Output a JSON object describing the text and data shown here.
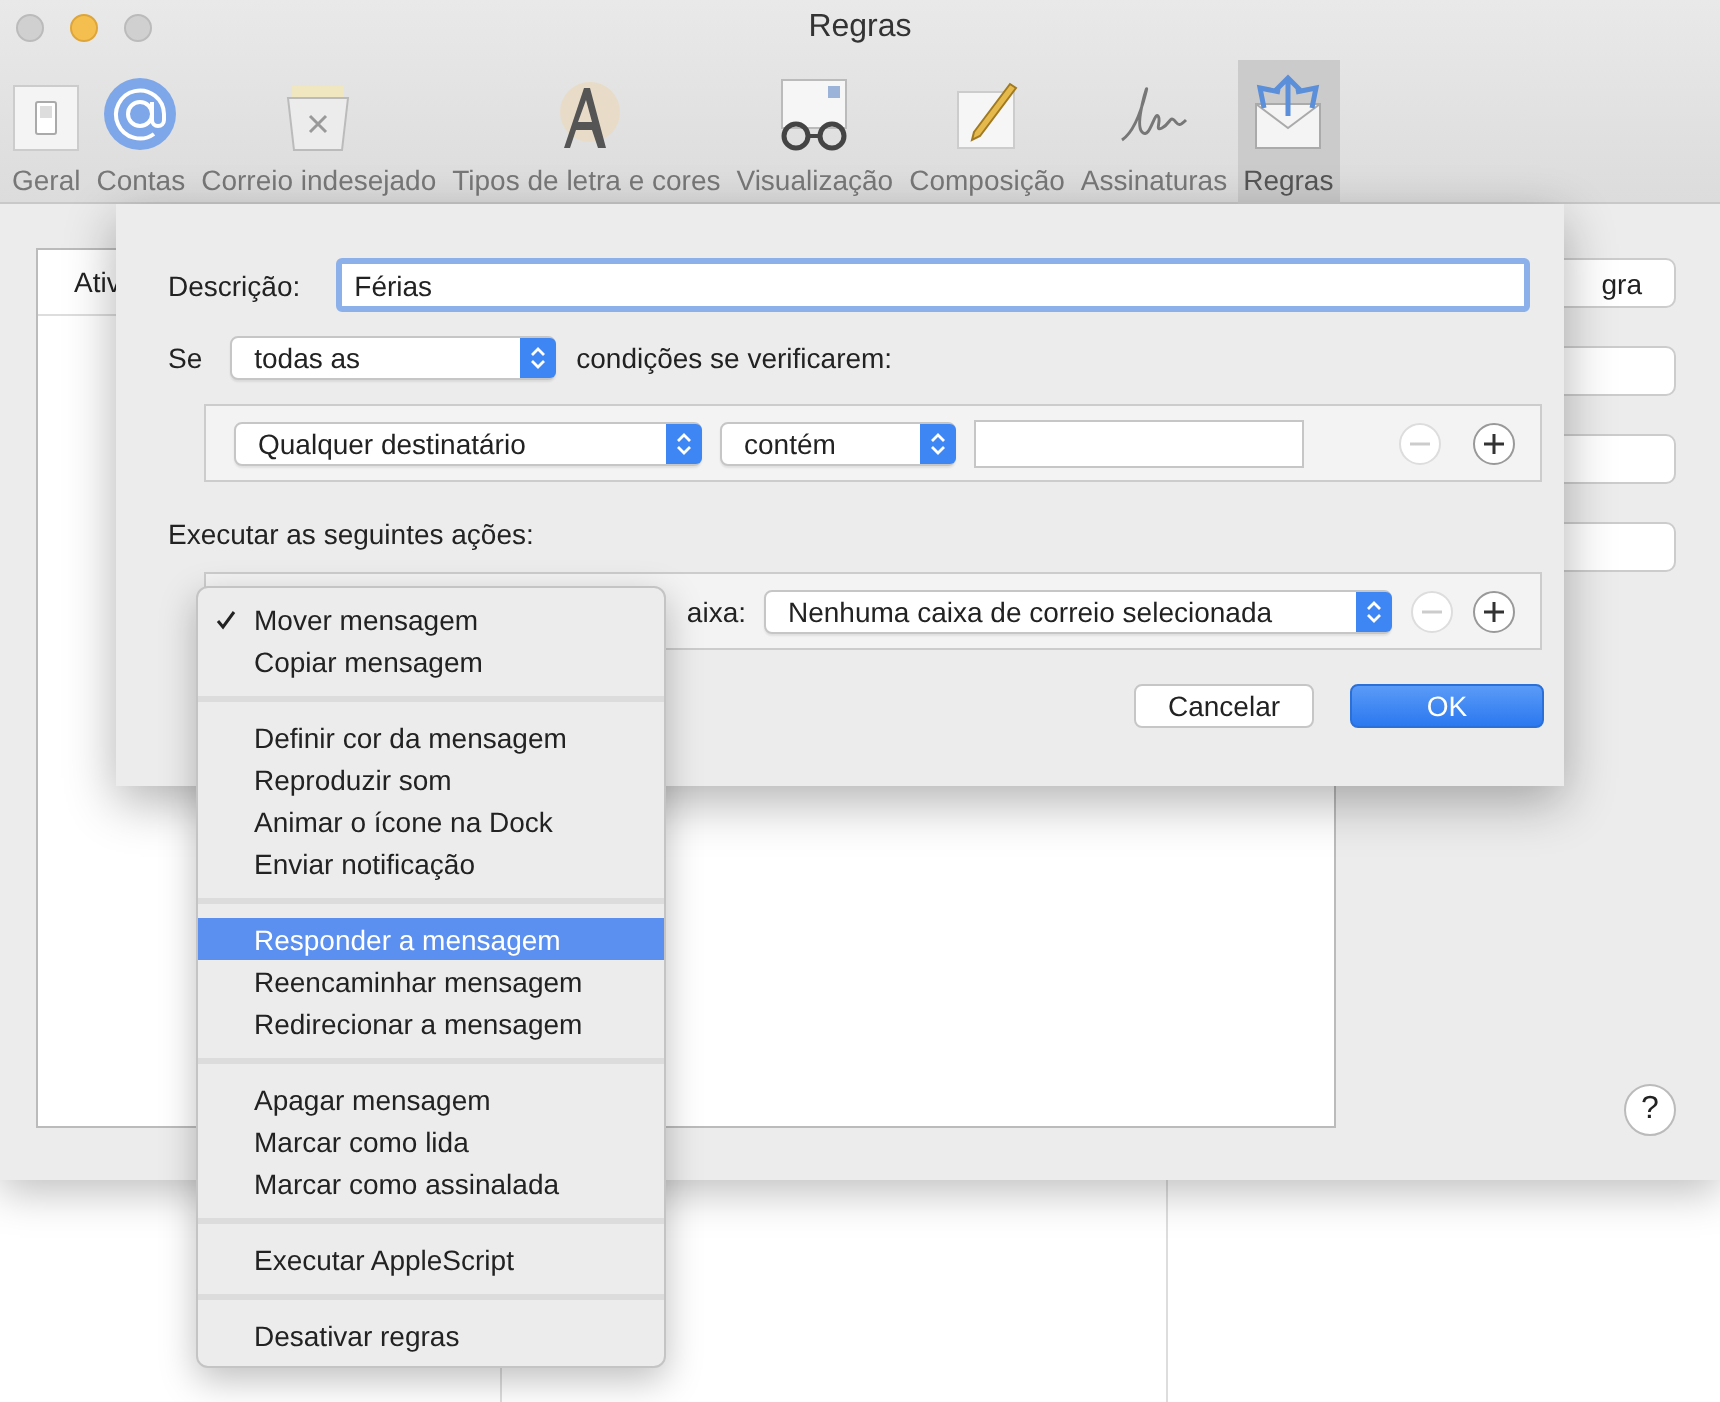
{
  "window": {
    "title": "Regras"
  },
  "toolbar": [
    {
      "label": "Geral",
      "selected": false
    },
    {
      "label": "Contas",
      "selected": false
    },
    {
      "label": "Correio indesejado",
      "selected": false
    },
    {
      "label": "Tipos de letra e cores",
      "selected": false
    },
    {
      "label": "Visualização",
      "selected": false
    },
    {
      "label": "Composição",
      "selected": false
    },
    {
      "label": "Assinaturas",
      "selected": false
    },
    {
      "label": "Regras",
      "selected": true
    }
  ],
  "rules_list": {
    "column_1": "Ativ"
  },
  "side_button": {
    "label": "gra"
  },
  "help_button": {
    "label": "?"
  },
  "sheet": {
    "description_label": "Descrição:",
    "description_value": "Férias",
    "if_label": "Se",
    "match_popup": "todas as",
    "conditions_suffix": "condições se verificarem:",
    "conditions": [
      {
        "field": "Qualquer destinatário",
        "operator": "contém",
        "remove_disabled": true
      }
    ],
    "actions_label": "Executar as seguintes ações:",
    "actions": [
      {
        "label": "aixa:",
        "target": "Nenhuma caixa de correio selecionada",
        "remove_disabled": true
      }
    ],
    "buttons": [
      {
        "label": "Cancelar",
        "default": false
      },
      {
        "label": "OK",
        "default": true
      }
    ]
  },
  "menu": {
    "sections": [
      {
        "items": [
          {
            "label": "Mover mensagem",
            "checked": true,
            "selected": false
          },
          {
            "label": "Copiar mensagem",
            "checked": false,
            "selected": false
          }
        ]
      },
      {
        "items": [
          {
            "label": "Definir cor da mensagem",
            "checked": false,
            "selected": false
          },
          {
            "label": "Reproduzir som",
            "checked": false,
            "selected": false
          },
          {
            "label": "Animar o ícone na Dock",
            "checked": false,
            "selected": false
          },
          {
            "label": "Enviar notificação",
            "checked": false,
            "selected": false
          }
        ]
      },
      {
        "items": [
          {
            "label": "Responder a mensagem",
            "checked": false,
            "selected": true
          },
          {
            "label": "Reencaminhar mensagem",
            "checked": false,
            "selected": false
          },
          {
            "label": "Redirecionar a mensagem",
            "checked": false,
            "selected": false
          }
        ]
      },
      {
        "items": [
          {
            "label": "Apagar mensagem",
            "checked": false,
            "selected": false
          },
          {
            "label": "Marcar como lida",
            "checked": false,
            "selected": false
          },
          {
            "label": "Marcar como assinalada",
            "checked": false,
            "selected": false
          }
        ]
      },
      {
        "items": [
          {
            "label": "Executar AppleScript",
            "checked": false,
            "selected": false
          }
        ]
      },
      {
        "items": [
          {
            "label": "Desativar regras",
            "checked": false,
            "selected": false
          }
        ]
      }
    ]
  }
}
